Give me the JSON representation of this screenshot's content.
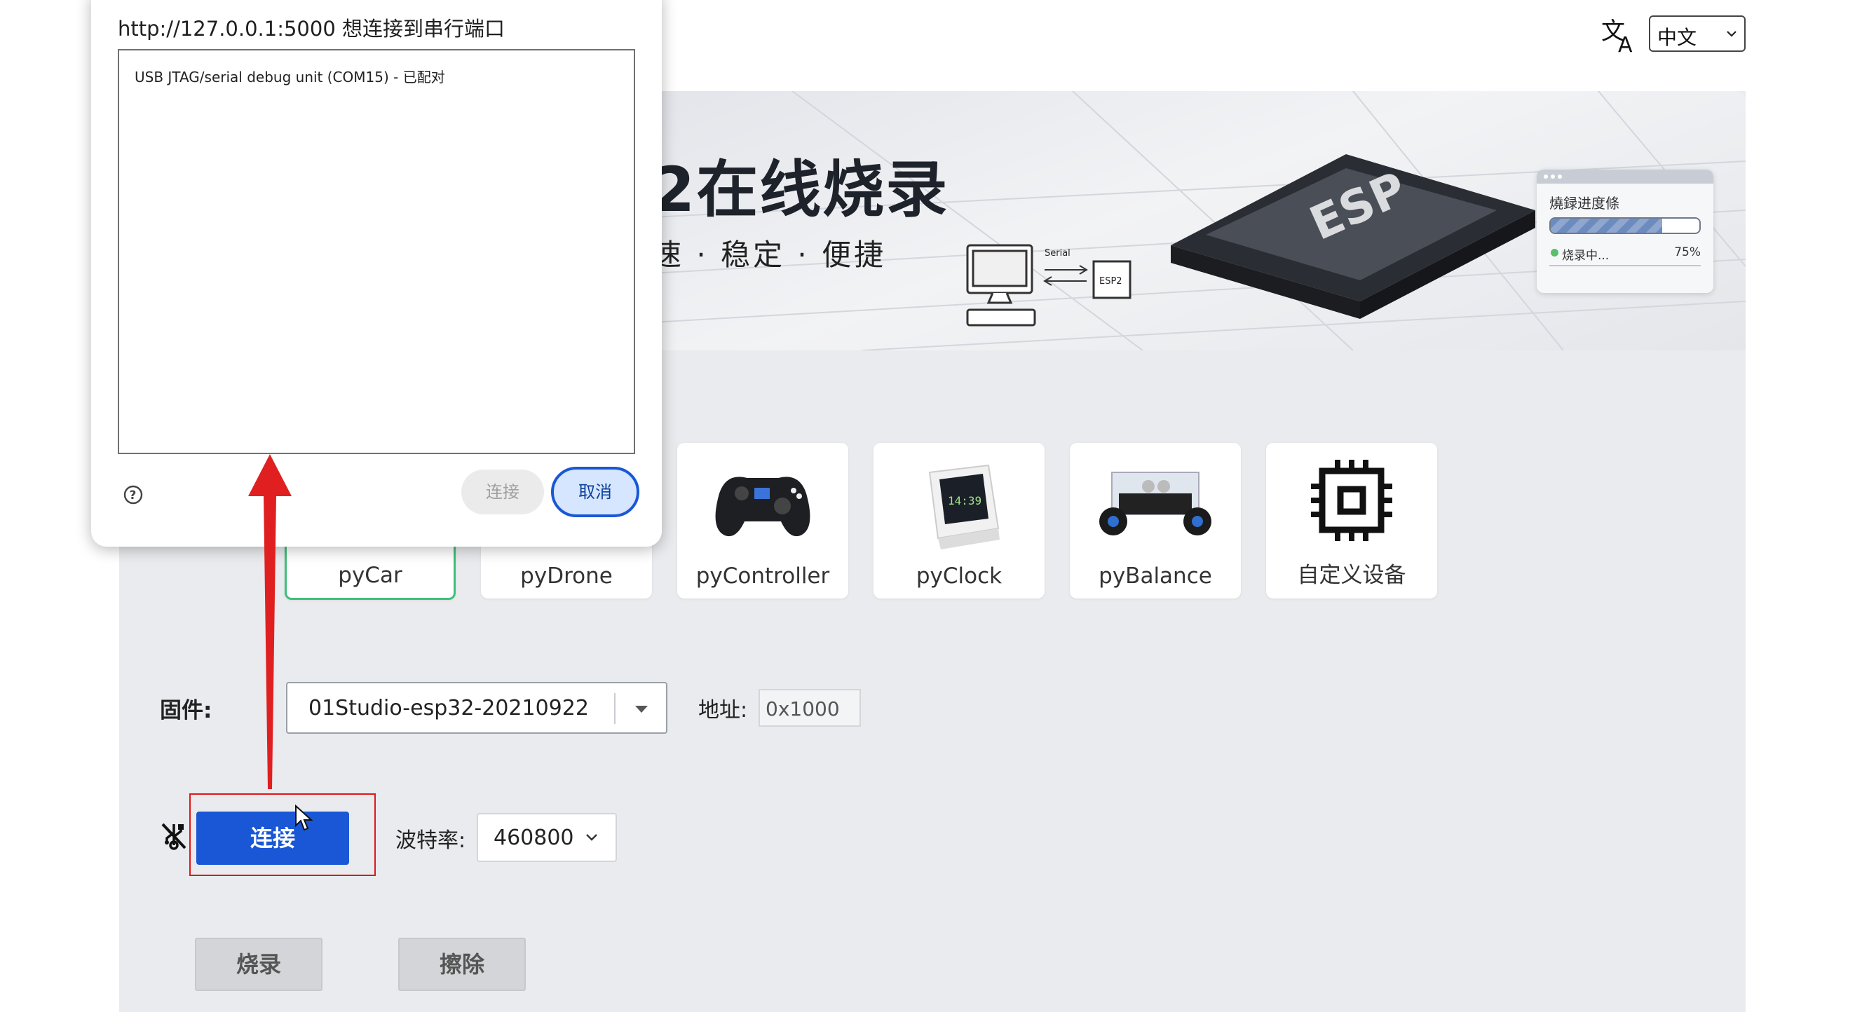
{
  "header": {
    "language": {
      "icon": "translate-icon",
      "selected": "中文"
    }
  },
  "banner": {
    "title_visible": "2在线烧录",
    "subtitle_visible": "速 · 稳定 · 便捷",
    "illustration": {
      "chip_label": "ESP",
      "serial_label": "Serial",
      "target_label": "ESP2",
      "progress_card": {
        "title": "燒録进度條",
        "status": "烧录中...",
        "percent_text": "75%",
        "percent": 75
      }
    }
  },
  "devices": [
    {
      "label": "pyCar",
      "selected": true
    },
    {
      "label": "pyDrone",
      "selected": false
    },
    {
      "label": "pyController",
      "selected": false,
      "icon": "gamepad-icon"
    },
    {
      "label": "pyClock",
      "selected": false,
      "icon": "clock-device-icon"
    },
    {
      "label": "pyBalance",
      "selected": false,
      "icon": "robot-car-icon"
    },
    {
      "label": "自定义设备",
      "selected": false,
      "icon": "chip-icon"
    }
  ],
  "firmware": {
    "label": "固件:",
    "value": "01Studio-esp32-20210922",
    "address_label": "地址:",
    "address_value": "0x1000"
  },
  "connection": {
    "status_icon": "usb-disconnected-icon",
    "connect_label": "连接",
    "baud_label": "波特率:",
    "baud_value": "460800"
  },
  "actions": {
    "flash_label": "烧录",
    "erase_label": "擦除"
  },
  "serial_dialog": {
    "title": "http://127.0.0.1:5000 想连接到串行端口",
    "ports": [
      "USB JTAG/serial debug unit (COM15) - 已配对"
    ],
    "help_icon": "help-icon",
    "connect_label": "连接",
    "cancel_label": "取消"
  },
  "annotation": {
    "arrow_color": "#e02020",
    "highlight_color": "#e01818"
  },
  "colors": {
    "primary": "#1a57d6",
    "selected_border": "#3fbf7a",
    "panel_bg": "#e9ebee"
  }
}
